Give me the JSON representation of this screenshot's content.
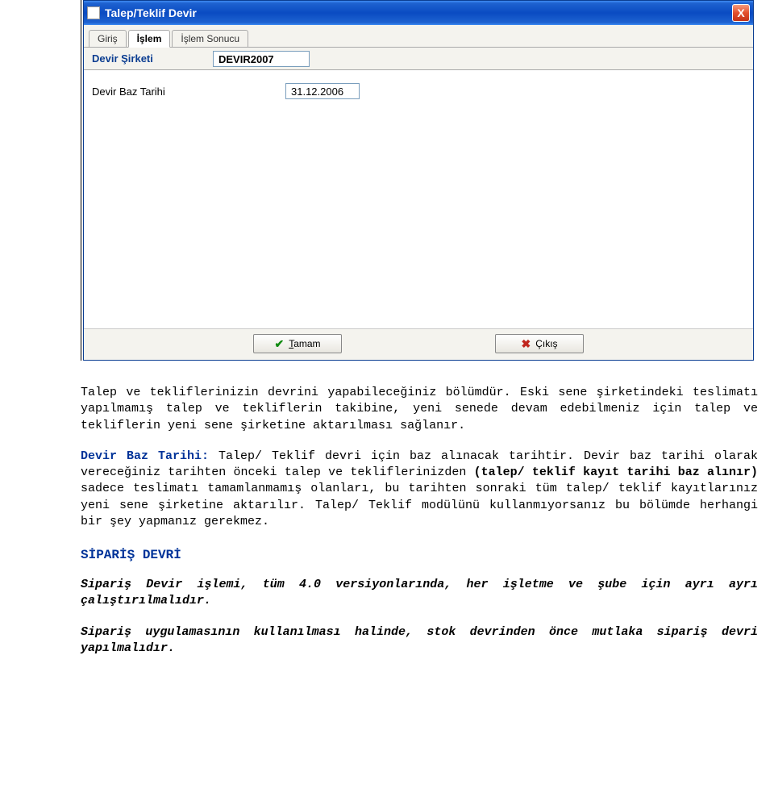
{
  "window": {
    "title": "Talep/Teklif Devir",
    "close_glyph": "X",
    "tabs": [
      {
        "label": "Giriş",
        "active": false
      },
      {
        "label": "İşlem",
        "active": true
      },
      {
        "label": "İşlem Sonucu",
        "active": false
      }
    ],
    "header": {
      "label": "Devir Şirketi",
      "value": "DEVIR2007"
    },
    "field": {
      "label": "Devir Baz Tarihi",
      "value": "31.12.2006"
    },
    "buttons": {
      "ok": "Tamam",
      "exit": "Çıkış"
    }
  },
  "doc": {
    "p1": "Talep ve tekliflerinizin devrini yapabileceğiniz bölümdür. Eski sene şirketindeki teslimatı yapılmamış talep ve tekliflerin takibine, yeni senede devam edebilmeniz için talep ve tekliflerin yeni sene şirketine aktarılması sağlanır.",
    "p2_label": "Devir Baz Tarihi:",
    "p2a": " Talep/ Teklif devri için baz alınacak tarihtir. Devir baz tarihi olarak vereceğiniz tarihten önceki talep ve tekliflerinizden ",
    "p2_bold": "(talep/ teklif kayıt tarihi baz alınır)",
    "p2b": " sadece teslimatı tamamlanmamış olanları, bu tarihten sonraki tüm talep/ teklif kayıtlarınız yeni sene şirketine aktarılır. Talep/ Teklif modülünü kullanmıyorsanız bu bölümde herhangi bir şey yapmanız gerekmez.",
    "h_order": "SİPARİŞ DEVRİ",
    "p3": "Sipariş Devir işlemi, tüm 4.0 versiyonlarında, her işletme ve şube için ayrı ayrı çalıştırılmalıdır.",
    "p4": "Sipariş uygulamasının kullanılması halinde, stok devrinden önce mutlaka sipariş devri yapılmalıdır."
  }
}
